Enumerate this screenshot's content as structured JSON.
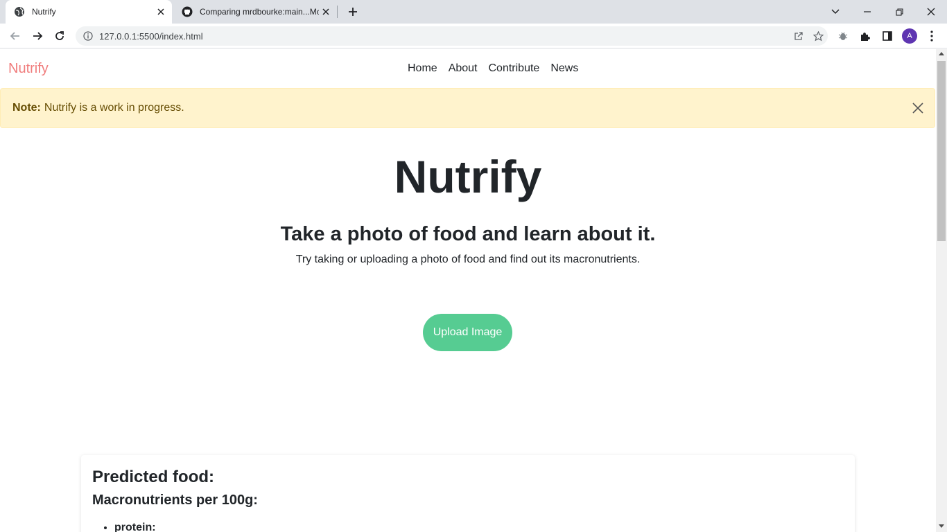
{
  "browser": {
    "tabs": [
      {
        "title": "Nutrify",
        "active": true,
        "icon": "globe-icon"
      },
      {
        "title": "Comparing mrdbourke:main...Mc",
        "active": false,
        "icon": "github-icon"
      }
    ],
    "url": "127.0.0.1:5500/index.html",
    "avatar_letter": "A",
    "avatar_color": "#5e35b1"
  },
  "site": {
    "brand": "Nutrify",
    "brand_color": "#f07d7d",
    "nav": [
      "Home",
      "About",
      "Contribute",
      "News"
    ]
  },
  "alert": {
    "label": "Note:",
    "message": "Nutrify is a work in progress."
  },
  "hero": {
    "title": "Nutrify",
    "subtitle": "Take a photo of food and learn about it.",
    "text": "Try taking or uploading a photo of food and find out its macronutrients."
  },
  "upload": {
    "label": "Upload Image",
    "color": "#56cc92"
  },
  "results": {
    "predicted_label": "Predicted food:",
    "macros_label": "Macronutrients per 100g:",
    "macros": [
      "protein:"
    ]
  }
}
